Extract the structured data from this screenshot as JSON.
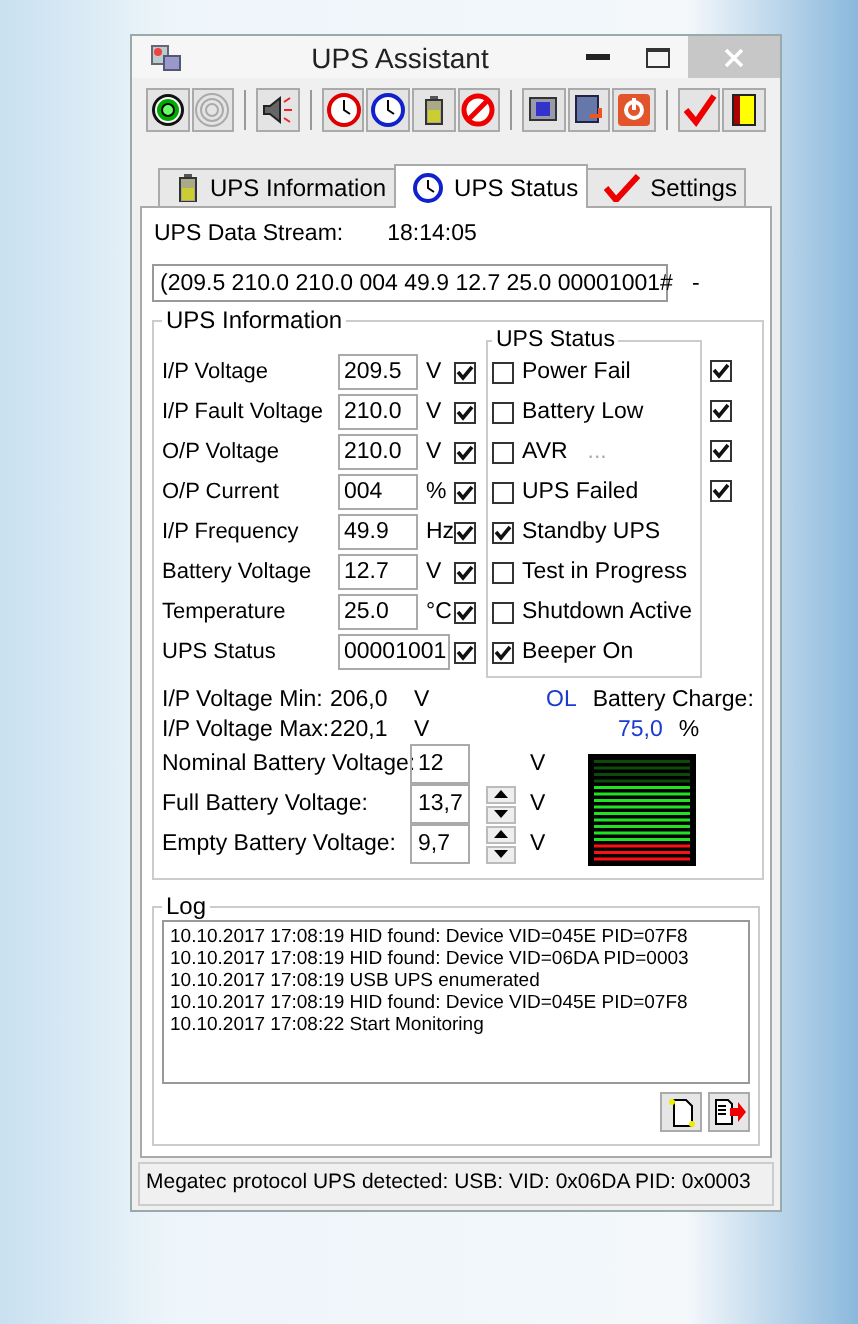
{
  "window": {
    "title": "UPS Assistant"
  },
  "tabs": [
    {
      "label": "UPS Information",
      "selected": false,
      "kind": "battery"
    },
    {
      "label": "UPS Status",
      "selected": true,
      "kind": "clock"
    },
    {
      "label": "Settings",
      "selected": false,
      "kind": "check"
    }
  ],
  "data_stream": {
    "label": "UPS Data Stream:",
    "time": "18:14:05",
    "value": "(209.5 210.0 210.0 004 49.9 12.7 25.0 00001001#",
    "suffix": "-"
  },
  "ups_information": {
    "title": "UPS Information",
    "rows": [
      {
        "label": "I/P Voltage",
        "value": "209.5",
        "unit": "V",
        "checked": true
      },
      {
        "label": "I/P Fault Voltage",
        "value": "210.0",
        "unit": "V",
        "checked": true
      },
      {
        "label": "O/P Voltage",
        "value": "210.0",
        "unit": "V",
        "checked": true
      },
      {
        "label": "O/P Current",
        "value": "004",
        "unit": "%",
        "checked": true
      },
      {
        "label": "I/P Frequency",
        "value": "49.9",
        "unit": "Hz",
        "checked": true
      },
      {
        "label": "Battery Voltage",
        "value": "12.7",
        "unit": "V",
        "checked": true
      },
      {
        "label": "Temperature",
        "value": "25.0",
        "unit": "°C",
        "checked": true
      },
      {
        "label": "UPS Status",
        "value": "00001001",
        "checked": true
      }
    ]
  },
  "ups_status": {
    "title": "UPS Status",
    "rows": [
      {
        "label": "Power Fail",
        "checked": false,
        "alert": true
      },
      {
        "label": "Battery Low",
        "checked": false,
        "alert": true
      },
      {
        "label": "AVR",
        "note": "...",
        "checked": false,
        "alert": true
      },
      {
        "label": "UPS Failed",
        "checked": false,
        "alert": true
      },
      {
        "label": "Standby UPS",
        "checked": true
      },
      {
        "label": "Test in Progress",
        "checked": false
      },
      {
        "label": "Shutdown Active",
        "checked": false
      },
      {
        "label": "Beeper On",
        "checked": true
      }
    ]
  },
  "voltage_range": [
    {
      "label": "I/P Voltage Min:",
      "value": "206,0",
      "unit": "V"
    },
    {
      "label": "I/P Voltage Max:",
      "value": "220,1",
      "unit": "V"
    }
  ],
  "mode": "OL",
  "battery_charge": {
    "label": "Battery Charge:",
    "value": "75,0",
    "unit": "%",
    "level": 0.75
  },
  "battery_settings": [
    {
      "label": "Nominal Battery Voltage:",
      "value": "12",
      "unit": "V",
      "spinner": false
    },
    {
      "label": "Full Battery Voltage:",
      "value": "13,7",
      "unit": "V",
      "spinner": true
    },
    {
      "label": "Empty Battery Voltage:",
      "value": "9,7",
      "unit": "V",
      "spinner": true
    }
  ],
  "log": {
    "title": "Log",
    "entries": [
      "10.10.2017 17:08:19 HID found: Device VID=045E PID=07F8",
      "10.10.2017 17:08:19 HID found: Device VID=06DA PID=0003",
      "10.10.2017 17:08:19 USB UPS enumerated",
      "10.10.2017 17:08:19 HID found: Device VID=045E PID=07F8",
      "10.10.2017 17:08:22 Start Monitoring"
    ]
  },
  "status_bar": "Megatec protocol UPS detected: USB: VID: 0x06DA PID: 0x0003"
}
